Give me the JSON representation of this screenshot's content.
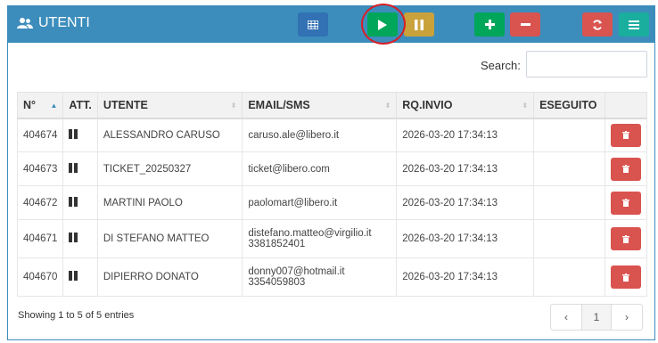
{
  "panel": {
    "title": "UTENTI"
  },
  "search": {
    "label": "Search:",
    "value": "",
    "placeholder": ""
  },
  "table": {
    "headers": [
      "N°",
      "ATT.",
      "UTENTE",
      "EMAIL/SMS",
      "RQ.INVIO",
      "ESEGUITO",
      ""
    ],
    "rows": [
      {
        "id": "404674",
        "utente": "ALESSANDRO CARUSO",
        "email": "caruso.ale@libero.it",
        "sms": "",
        "rqinvio": "2026-03-20 17:34:13",
        "eseguito": ""
      },
      {
        "id": "404673",
        "utente": "TICKET_20250327",
        "email": "ticket@libero.com",
        "sms": "",
        "rqinvio": "2026-03-20 17:34:13",
        "eseguito": ""
      },
      {
        "id": "404672",
        "utente": "MARTINI PAOLO",
        "email": "paolomart@libero.it",
        "sms": "",
        "rqinvio": "2026-03-20 17:34:13",
        "eseguito": ""
      },
      {
        "id": "404671",
        "utente": "DI STEFANO MATTEO",
        "email": "distefano.matteo@virgilio.it",
        "sms": "3381852401",
        "rqinvio": "2026-03-20 17:34:13",
        "eseguito": ""
      },
      {
        "id": "404670",
        "utente": "DIPIERRO DONATO",
        "email": "donny007@hotmail.it",
        "sms": "3354059803",
        "rqinvio": "2026-03-20 17:34:13",
        "eseguito": ""
      }
    ]
  },
  "footer": {
    "info": "Showing 1 to 5 of 5 entries"
  },
  "pagination": {
    "prev": "‹",
    "page": "1",
    "next": "›"
  },
  "icons": {
    "title": "users-icon",
    "table": "table-icon",
    "play": "play-icon",
    "pause": "pause-icon",
    "add": "plus-icon",
    "remove": "minus-icon",
    "refresh": "refresh-icon",
    "menu": "menu-icon",
    "row_status": "pause-icon",
    "row_delete": "trash-icon"
  },
  "colors": {
    "header": "#3c8dbc",
    "play": "#00a65a",
    "pause": "#c9a23c",
    "add": "#00a65a",
    "remove": "#d9534f",
    "refresh": "#d9534f",
    "menu": "#1aae9e",
    "table": "#3271b4",
    "annotation": "#d61e27"
  }
}
